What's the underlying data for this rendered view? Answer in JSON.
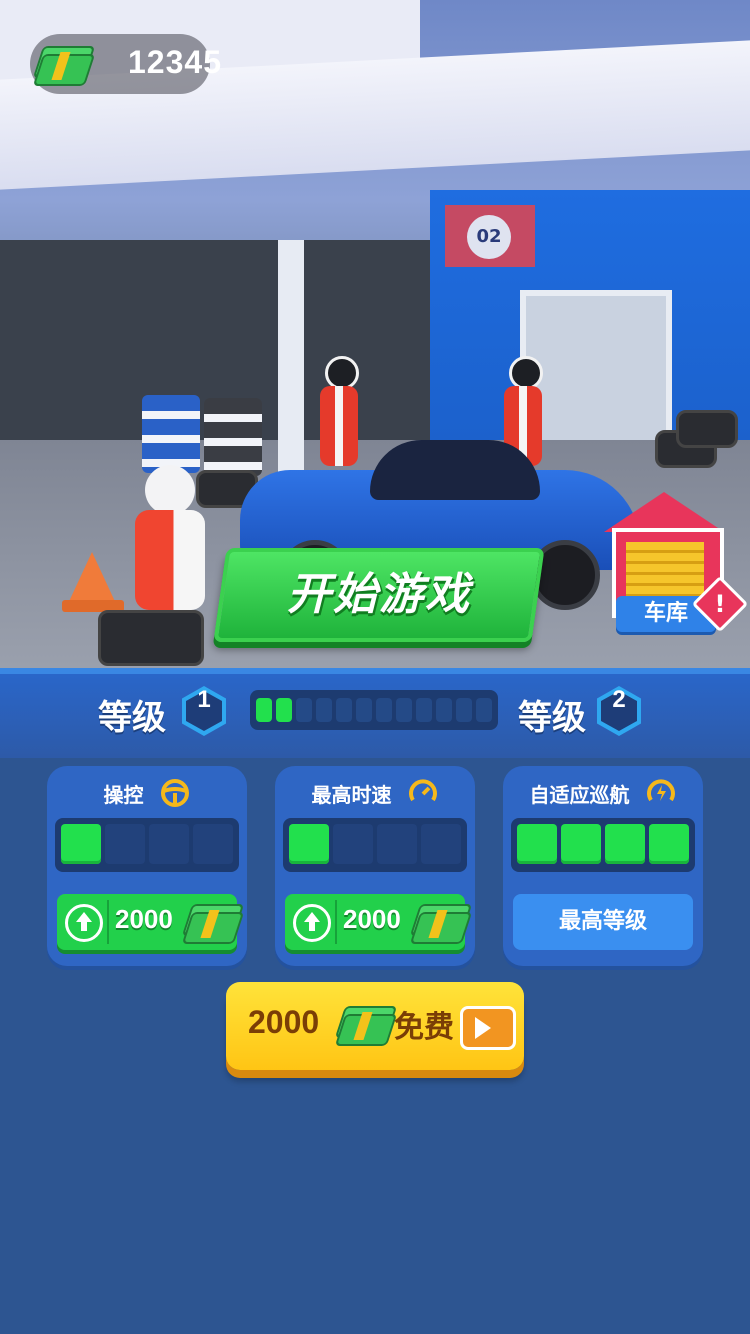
{
  "hud": {
    "cash": "12345",
    "cash_icon": "cash-stack-icon"
  },
  "play_button": {
    "label": "开始游戏"
  },
  "garage": {
    "label": "车库",
    "badge": "!",
    "icon": "garage-icon"
  },
  "scene": {
    "sign_number": "02"
  },
  "level": {
    "current_label": "等级",
    "current_value": "1",
    "next_label": "等级",
    "next_value": "2",
    "progress_total": 12,
    "progress_filled": 2
  },
  "upgrades": [
    {
      "title": "操控",
      "icon": "steering-wheel-icon",
      "level": 1,
      "max": 4,
      "price": "2000"
    },
    {
      "title": "最高时速",
      "icon": "speedometer-icon",
      "level": 1,
      "max": 4,
      "price": "2000"
    },
    {
      "title": "自适应巡航",
      "icon": "cruise-control-icon",
      "level": 4,
      "max": 4,
      "max_label": "最高等级"
    }
  ],
  "free_reward": {
    "amount": "2000",
    "label": "免费",
    "icon": "video-ad-icon"
  },
  "colors": {
    "accent_green": "#22e04d",
    "panel_blue": "#2f66c4",
    "background": "#2d5591",
    "gold": "#ffc514"
  }
}
